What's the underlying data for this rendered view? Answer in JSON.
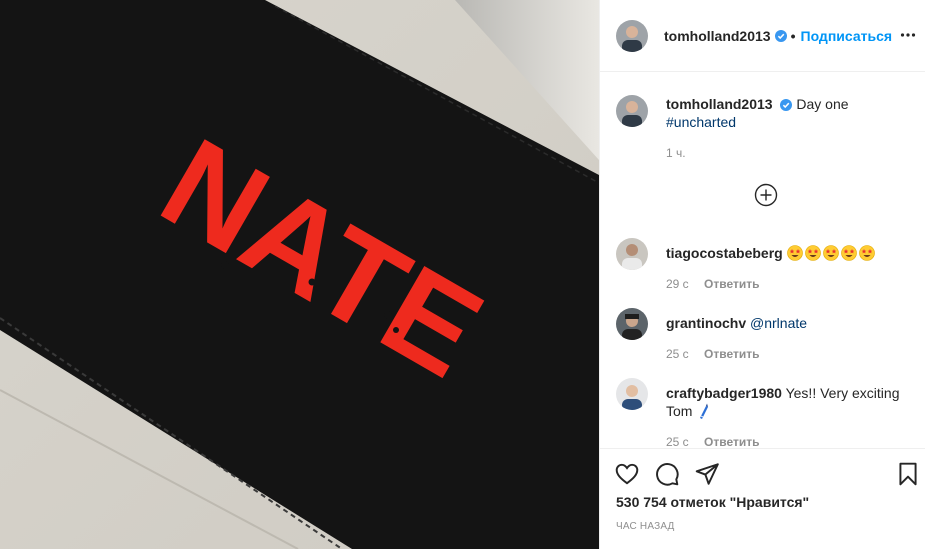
{
  "post": {
    "author": "tomholland2013",
    "follow_label": "Подписаться",
    "separator": "•",
    "caption_text": "Day one",
    "caption_hashtag": "#uncharted",
    "caption_time": "1 ч."
  },
  "photo": {
    "printed_text": "NATE",
    "colors": {
      "fabric": "#141414",
      "print": "#ee2a1e",
      "background": "#d9d6cf"
    }
  },
  "comments": [
    {
      "username": "tiagocostabeberg",
      "text": "",
      "emoji": [
        "star-struck",
        "star-struck",
        "star-struck",
        "star-struck",
        "star-struck"
      ],
      "time": "29 с",
      "reply_label": "Ответить"
    },
    {
      "username": "grantinochv",
      "text": "",
      "mention": "@nrlnate",
      "time": "25 с",
      "reply_label": "Ответить"
    },
    {
      "username": "craftybadger1980",
      "text": "Yes!! Very exciting Tom",
      "emoji": [
        "crayon"
      ],
      "time": "25 с",
      "reply_label": "Ответить"
    }
  ],
  "actions": {
    "likes_text": "530 754 отметок \"Нравится\"",
    "timestamp": "ЧАС НАЗАД",
    "icons": [
      "heart-icon",
      "comment-icon",
      "share-icon",
      "bookmark-icon"
    ]
  },
  "theme": {
    "accent": "#0095f6",
    "verified": "#3897f0",
    "muted": "#8e8e8e",
    "border": "#efefef"
  }
}
